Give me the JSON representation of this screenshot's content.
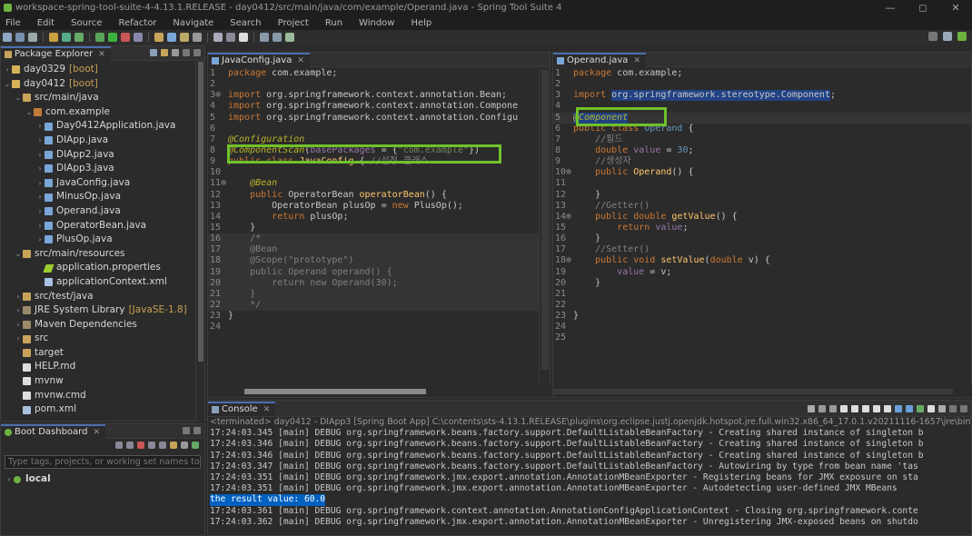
{
  "window": {
    "title": "workspace-spring-tool-suite-4-4.13.1.RELEASE - day0412/src/main/java/com/example/Operand.java - Spring Tool Suite 4",
    "controls": [
      "—",
      "◻",
      "✕"
    ]
  },
  "menu": [
    "File",
    "Edit",
    "Source",
    "Refactor",
    "Navigate",
    "Search",
    "Project",
    "Run",
    "Window",
    "Help"
  ],
  "colors": {
    "accent_highlight": "#6fc22a",
    "selection": "#214283",
    "console_result_bg": "#0060c0"
  },
  "package_explorer": {
    "tab_label": "Package Explorer",
    "items": [
      {
        "label": "day0329",
        "deco": "[boot]",
        "arrow": ">",
        "indent": 0,
        "icon": "project-icon"
      },
      {
        "label": "day0412",
        "deco": "[boot]",
        "arrow": "v",
        "indent": 0,
        "icon": "project-icon"
      },
      {
        "label": "src/main/java",
        "deco": "",
        "arrow": "v",
        "indent": 1,
        "icon": "source-folder-icon"
      },
      {
        "label": "com.example",
        "deco": "",
        "arrow": "v",
        "indent": 2,
        "icon": "package-icon"
      },
      {
        "label": "Day0412Application.java",
        "deco": "",
        "arrow": ">",
        "indent": 3,
        "icon": "java-file-icon"
      },
      {
        "label": "DIApp.java",
        "deco": "",
        "arrow": ">",
        "indent": 3,
        "icon": "java-file-icon"
      },
      {
        "label": "DIApp2.java",
        "deco": "",
        "arrow": ">",
        "indent": 3,
        "icon": "java-file-icon"
      },
      {
        "label": "DIApp3.java",
        "deco": "",
        "arrow": ">",
        "indent": 3,
        "icon": "java-file-icon"
      },
      {
        "label": "JavaConfig.java",
        "deco": "",
        "arrow": ">",
        "indent": 3,
        "icon": "java-file-icon"
      },
      {
        "label": "MinusOp.java",
        "deco": "",
        "arrow": ">",
        "indent": 3,
        "icon": "java-file-icon"
      },
      {
        "label": "Operand.java",
        "deco": "",
        "arrow": ">",
        "indent": 3,
        "icon": "java-file-icon"
      },
      {
        "label": "OperatorBean.java",
        "deco": "",
        "arrow": ">",
        "indent": 3,
        "icon": "java-file-icon"
      },
      {
        "label": "PlusOp.java",
        "deco": "",
        "arrow": ">",
        "indent": 3,
        "icon": "java-file-icon"
      },
      {
        "label": "src/main/resources",
        "deco": "",
        "arrow": "v",
        "indent": 1,
        "icon": "source-folder-icon"
      },
      {
        "label": "application.properties",
        "deco": "",
        "arrow": "",
        "indent": 3,
        "icon": "properties-file-icon"
      },
      {
        "label": "applicationContext.xml",
        "deco": "",
        "arrow": "",
        "indent": 3,
        "icon": "xml-file-icon"
      },
      {
        "label": "src/test/java",
        "deco": "",
        "arrow": ">",
        "indent": 1,
        "icon": "source-folder-icon"
      },
      {
        "label": "JRE System Library",
        "deco": "[JavaSE-1.8]",
        "arrow": ">",
        "indent": 1,
        "icon": "library-icon"
      },
      {
        "label": "Maven Dependencies",
        "deco": "",
        "arrow": ">",
        "indent": 1,
        "icon": "library-icon"
      },
      {
        "label": "src",
        "deco": "",
        "arrow": ">",
        "indent": 1,
        "icon": "folder-icon"
      },
      {
        "label": "target",
        "deco": "",
        "arrow": "",
        "indent": 1,
        "icon": "folder-icon"
      },
      {
        "label": "HELP.md",
        "deco": "",
        "arrow": "",
        "indent": 1,
        "icon": "file-icon"
      },
      {
        "label": "mvnw",
        "deco": "",
        "arrow": "",
        "indent": 1,
        "icon": "file-icon"
      },
      {
        "label": "mvnw.cmd",
        "deco": "",
        "arrow": "",
        "indent": 1,
        "icon": "file-icon"
      },
      {
        "label": "pom.xml",
        "deco": "",
        "arrow": "",
        "indent": 1,
        "icon": "xml-file-icon"
      }
    ]
  },
  "boot_dashboard": {
    "tab_label": "Boot Dashboard",
    "search_placeholder": "Type tags, projects, or working set names to m",
    "local_label": "local"
  },
  "editor_left": {
    "tab_label": "JavaConfig.java",
    "lines": [
      [
        [
          "kw",
          "package "
        ],
        [
          "src",
          "com.example;"
        ]
      ],
      [],
      [
        [
          "kw",
          "import "
        ],
        [
          "src",
          "org.springframework.context.annotation.Bean;"
        ]
      ],
      [
        [
          "kw",
          "import "
        ],
        [
          "src",
          "org.springframework.context.annotation.Compone"
        ]
      ],
      [
        [
          "kw",
          "import "
        ],
        [
          "src",
          "org.springframework.context.annotation.Configu"
        ]
      ],
      [],
      [
        [
          "an",
          "@Configuration"
        ]
      ],
      [
        [
          "an",
          "@ComponentScan"
        ],
        [
          "src",
          "("
        ],
        [
          "fld",
          "basePackages"
        ],
        [
          "src",
          " = {"
        ],
        [
          "st",
          "\"com.example\""
        ],
        [
          "src",
          "})"
        ]
      ],
      [
        [
          "kw",
          "public class "
        ],
        [
          "fn",
          "JavaConfig"
        ],
        [
          "src",
          " { "
        ],
        [
          "cm",
          "//설정 클래스"
        ]
      ],
      [],
      [
        [
          "src",
          "    "
        ],
        [
          "an",
          "@Bean"
        ]
      ],
      [
        [
          "src",
          "    "
        ],
        [
          "kw",
          "public "
        ],
        [
          "src",
          "OperatorBean "
        ],
        [
          "fn",
          "operatorBean"
        ],
        [
          "src",
          "() {"
        ]
      ],
      [
        [
          "src",
          "        OperatorBean "
        ],
        [
          "src",
          "plusOp"
        ],
        [
          "src",
          " = "
        ],
        [
          "kw",
          "new "
        ],
        [
          "src",
          "PlusOp();"
        ]
      ],
      [
        [
          "src",
          "        "
        ],
        [
          "kw",
          "return "
        ],
        [
          "src",
          "plusOp;"
        ]
      ],
      [
        [
          "src",
          "    }"
        ]
      ],
      [
        [
          "cm",
          "    /*"
        ]
      ],
      [
        [
          "cm",
          "    @Bean"
        ]
      ],
      [
        [
          "cm",
          "    @Scope(\"prototype\")"
        ]
      ],
      [
        [
          "cm",
          "    public Operand operand() {"
        ]
      ],
      [
        [
          "cm",
          "        return new Operand(30);"
        ]
      ],
      [
        [
          "cm",
          "    }"
        ]
      ],
      [
        [
          "cm",
          "    */"
        ]
      ],
      [
        [
          "src",
          "}"
        ]
      ],
      []
    ],
    "line_numbers": [
      "1",
      "2",
      "3⊕",
      "4",
      "5",
      "6",
      "7",
      "8",
      "9",
      "10",
      "11⊕",
      "12",
      "13",
      "14",
      "15",
      "16",
      "17",
      "18",
      "19",
      "20",
      "21",
      "22",
      "23",
      "24"
    ]
  },
  "editor_right": {
    "tab_label": "Operand.java",
    "lines": [
      [
        [
          "kw",
          "package "
        ],
        [
          "src",
          "com.example;"
        ]
      ],
      [],
      [
        [
          "kw",
          "import "
        ],
        [
          "sel",
          "org.springframework.stereotype.Component"
        ],
        [
          "src",
          ";"
        ]
      ],
      [],
      [
        [
          "selan",
          "@Component"
        ]
      ],
      [
        [
          "kw",
          "public class "
        ],
        [
          "ty",
          "Operand"
        ],
        [
          "src",
          " {"
        ]
      ],
      [
        [
          "cm",
          "    //필드"
        ]
      ],
      [
        [
          "src",
          "    "
        ],
        [
          "kw",
          "double "
        ],
        [
          "fld",
          "value"
        ],
        [
          "src",
          " = "
        ],
        [
          "num",
          "30"
        ],
        [
          "src",
          ";"
        ]
      ],
      [
        [
          "cm",
          "    //생성자"
        ]
      ],
      [
        [
          "src",
          "    "
        ],
        [
          "kw",
          "public "
        ],
        [
          "fn",
          "Operand"
        ],
        [
          "src",
          "() {"
        ]
      ],
      [],
      [
        [
          "src",
          "    }"
        ]
      ],
      [
        [
          "cm",
          "    //Getter()"
        ]
      ],
      [
        [
          "src",
          "    "
        ],
        [
          "kw",
          "public double "
        ],
        [
          "fn",
          "getValue"
        ],
        [
          "src",
          "() {"
        ]
      ],
      [
        [
          "src",
          "        "
        ],
        [
          "kw",
          "return "
        ],
        [
          "fld",
          "value"
        ],
        [
          "src",
          ";"
        ]
      ],
      [
        [
          "src",
          "    }"
        ]
      ],
      [
        [
          "cm",
          "    //Setter()"
        ]
      ],
      [
        [
          "src",
          "    "
        ],
        [
          "kw",
          "public void "
        ],
        [
          "fn",
          "setValue"
        ],
        [
          "src",
          "("
        ],
        [
          "kw",
          "double "
        ],
        [
          "src",
          "v) {"
        ]
      ],
      [
        [
          "src",
          "        "
        ],
        [
          "fld",
          "value"
        ],
        [
          "src",
          " = v;"
        ]
      ],
      [
        [
          "src",
          "    }"
        ]
      ],
      [],
      [],
      [
        [
          "src",
          "}"
        ]
      ],
      [],
      []
    ],
    "line_numbers": [
      "1",
      "2",
      "3",
      "4",
      "5",
      "6",
      "7",
      "8",
      "9",
      "10⊕",
      "11",
      "12",
      "13",
      "14⊕",
      "15",
      "16",
      "17",
      "18⊕",
      "19",
      "20",
      "21",
      "22",
      "23",
      "24",
      "25"
    ]
  },
  "console": {
    "tab_label": "Console",
    "terminated": "<terminated> day0412 - DIApp3 [Spring Boot App] C:\\contents\\sts-4.13.1.RELEASE\\plugins\\org.eclipse.justj.openjdk.hotspot.jre.full.win32.x86_64_17.0.1.v20211116-1657\\jre\\bin\\ja",
    "lines": [
      "17:24:03.345 [main] DEBUG org.springframework.beans.factory.support.DefaultListableBeanFactory - Creating shared instance of singleton b",
      "17:24:03.346 [main] DEBUG org.springframework.beans.factory.support.DefaultListableBeanFactory - Creating shared instance of singleton b",
      "17:24:03.346 [main] DEBUG org.springframework.beans.factory.support.DefaultListableBeanFactory - Creating shared instance of singleton b",
      "17:24:03.347 [main] DEBUG org.springframework.beans.factory.support.DefaultListableBeanFactory - Autowiring by type from bean name 'tas",
      "17:24:03.351 [main] DEBUG org.springframework.jmx.export.annotation.AnnotationMBeanExporter - Registering beans for JMX exposure on sta",
      "17:24:03.351 [main] DEBUG org.springframework.jmx.export.annotation.AnnotationMBeanExporter - Autodetecting user-defined JMX MBeans"
    ],
    "result": "the result value: 60.0",
    "lines_after": [
      "17:24:03.361 [main] DEBUG org.springframework.context.annotation.AnnotationConfigApplicationContext - Closing org.springframework.conte",
      "17:24:03.362 [main] DEBUG org.springframework.jmx.export.annotation.AnnotationMBeanExporter - Unregistering JMX-exposed beans on shutdo"
    ]
  }
}
